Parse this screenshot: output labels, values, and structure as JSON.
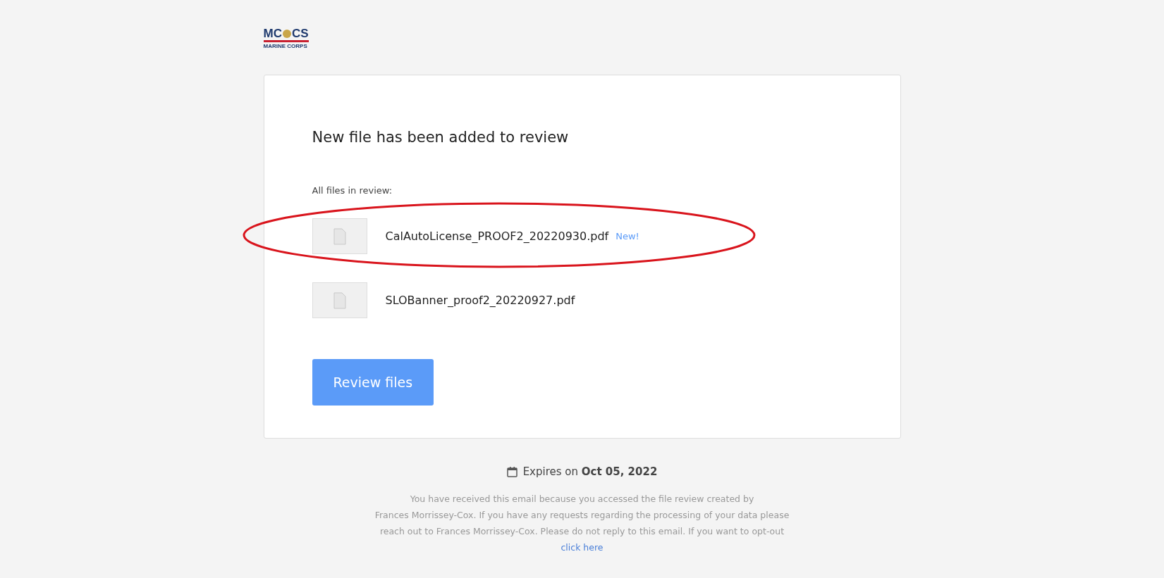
{
  "logo": {
    "mark_left": "MC",
    "mark_right": "CS",
    "subtitle": "MARINE CORPS"
  },
  "card": {
    "heading": "New file has been added to review",
    "files_label": "All files in review:",
    "files": [
      {
        "name": "CalAutoLicense_PROOF2_20220930.pdf",
        "badge": "New!",
        "circled": true
      },
      {
        "name": "SLOBanner_proof2_20220927.pdf",
        "circled": false
      }
    ],
    "button": "Review files"
  },
  "expiry": {
    "text": "Expires on **Oct 05, 2022**"
  },
  "footer": {
    "lines": [
      "You have received this email because you accessed the file review created by",
      "Frances Morrissey-Cox. If you have any requests regarding the processing of your data please",
      "reach out to Frances Morrissey-Cox. Please do not reply to this email. If you want to opt-out"
    ],
    "link": "click here"
  }
}
